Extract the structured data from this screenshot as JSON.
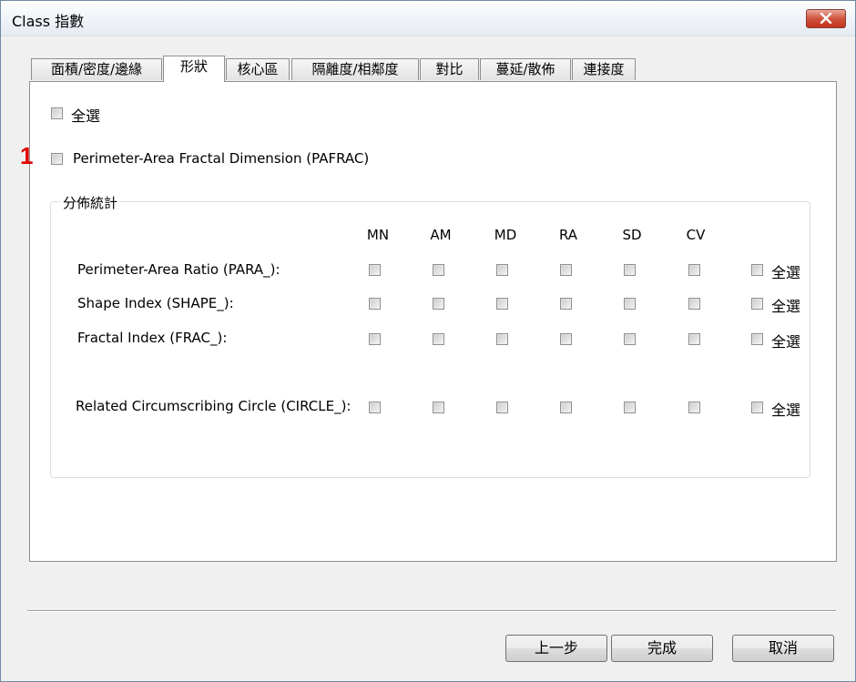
{
  "window": {
    "title": "Class 指數"
  },
  "tabs": [
    {
      "label": "面積/密度/邊緣"
    },
    {
      "label": "形狀"
    },
    {
      "label": "核心區"
    },
    {
      "label": "隔離度/相鄰度"
    },
    {
      "label": "對比"
    },
    {
      "label": "蔓延/散佈"
    },
    {
      "label": "連接度"
    }
  ],
  "active_tab": "形狀",
  "select_all_label": "全選",
  "marker_number": "1",
  "pafrac_label": "Perimeter-Area Fractal Dimension (PAFRAC)",
  "group": {
    "title": "分佈統計",
    "columns": [
      "MN",
      "AM",
      "MD",
      "RA",
      "SD",
      "CV"
    ],
    "rows": [
      {
        "label": "Perimeter-Area Ratio (PARA_):",
        "select_all": "全選"
      },
      {
        "label": "Shape Index (SHAPE_):",
        "select_all": "全選"
      },
      {
        "label": "Fractal Index (FRAC_):",
        "select_all": "全選"
      },
      {
        "label": "Related Circumscribing Circle (CIRCLE_):",
        "select_all": "全選"
      }
    ]
  },
  "buttons": {
    "back": "上一步",
    "finish": "完成",
    "cancel": "取消"
  },
  "colors": {
    "close_button": "#c2341c",
    "marker": "#e00000",
    "border": "#8e8f8f"
  }
}
